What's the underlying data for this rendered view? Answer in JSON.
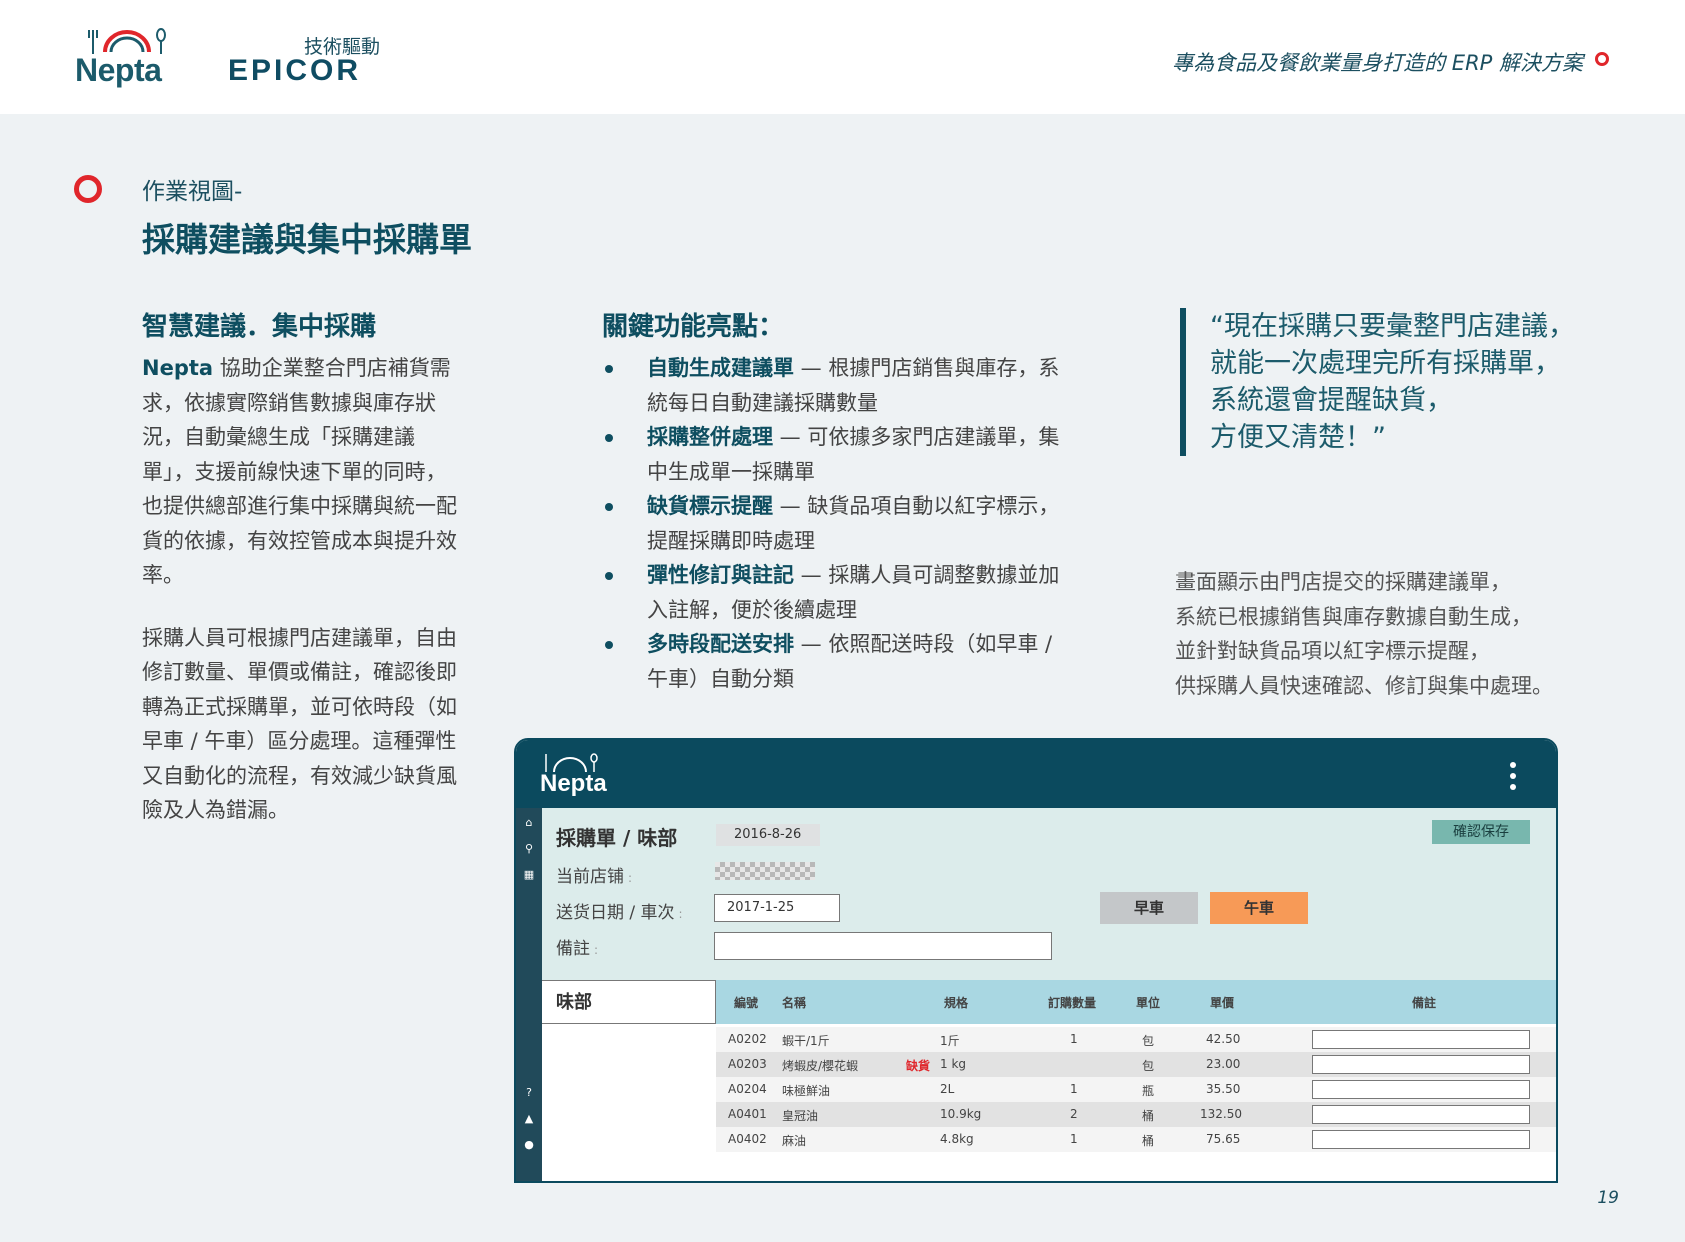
{
  "header": {
    "brand": "Nepta",
    "tagline": "技術驅動",
    "partner": "EPICOR",
    "slogan": "專為食品及餐飲業量身打造的 ERP 解決方案"
  },
  "section": {
    "subtitle": "作業視圖-",
    "title": "採購建議與集中採購單"
  },
  "left": {
    "heading": "智慧建議．集中採購",
    "brand": "Nepta",
    "para1": " 協助企業整合門店補貨需求，依據實際銷售數據與庫存狀況，自動彙總生成「採購建議單」，支援前線快速下單的同時，也提供總部進行集中採購與統一配貨的依據，有效控管成本與提升效率。",
    "para2": "採購人員可根據門店建議單，自由修訂數量、單價或備註，確認後即轉為正式採購單，並可依時段（如早車 / 午車）區分處理。這種彈性又自動化的流程，有效減少缺貨風險及人為錯漏。"
  },
  "middle": {
    "heading": "關鍵功能亮點：",
    "items": [
      {
        "key": "自動生成建議單",
        "desc": " — 根據門店銷售與庫存，系統每日自動建議採購數量"
      },
      {
        "key": "採購整併處理",
        "desc": " — 可依據多家門店建議單，集中生成單一採購單"
      },
      {
        "key": "缺貨標示提醒",
        "desc": " — 缺貨品項自動以紅字標示，提醒採購即時處理"
      },
      {
        "key": "彈性修訂與註記",
        "desc": " — 採購人員可調整數據並加入註解，便於後續處理"
      },
      {
        "key": "多時段配送安排",
        "desc": " — 依照配送時段（如早車 / 午車）自動分類"
      }
    ]
  },
  "right": {
    "quote_lines": [
      "“現在採購只要彙整門店建議，",
      "就能一次處理完所有採購單，",
      "系統還會提醒缺貨，",
      "方便又清楚！”"
    ],
    "caption_lines": [
      "畫面顯示由門店提交的採購建議單，",
      "系統已根據銷售與庫存數據自動生成，",
      "並針對缺貨品項以紅字標示提醒，",
      "供採購人員快速確認、修訂與集中處理。"
    ]
  },
  "app": {
    "brand": "Nepta",
    "form_title": "採購單 / 味部",
    "order_date": "2016-8-26",
    "confirm_label": "確認保存",
    "store_label": "当前店铺",
    "delivery_label": "送货日期 / 車次",
    "delivery_date": "2017-1-25",
    "note_label": "備註",
    "colon": ":",
    "trip_early": "早車",
    "trip_noon": "午車",
    "dept_tab": "味部",
    "columns": [
      "編號",
      "名稱",
      "規格",
      "訂購數量",
      "單位",
      "單價",
      "備註"
    ],
    "rows": [
      {
        "code": "A0202",
        "name": "蝦干/1斤",
        "flag": "",
        "spec": "1斤",
        "qty": "1",
        "unit": "包",
        "price": "42.50"
      },
      {
        "code": "A0203",
        "name": "烤蝦皮/櫻花蝦",
        "flag": "缺貨",
        "spec": "1 kg",
        "qty": "",
        "unit": "包",
        "price": "23.00"
      },
      {
        "code": "A0204",
        "name": "味極鮮油",
        "flag": "",
        "spec": "2L",
        "qty": "1",
        "unit": "瓶",
        "price": "35.50"
      },
      {
        "code": "A0401",
        "name": "皇冠油",
        "flag": "",
        "spec": "10.9kg",
        "qty": "2",
        "unit": "桶",
        "price": "132.50"
      },
      {
        "code": "A0402",
        "name": "麻油",
        "flag": "",
        "spec": "4.8kg",
        "qty": "1",
        "unit": "桶",
        "price": "75.65"
      }
    ]
  },
  "page_number": "19",
  "colors": {
    "primary": "#0e4e60",
    "accent_red": "#e0262b",
    "noon_orange": "#f79a57",
    "table_header": "#a9d7e2"
  }
}
